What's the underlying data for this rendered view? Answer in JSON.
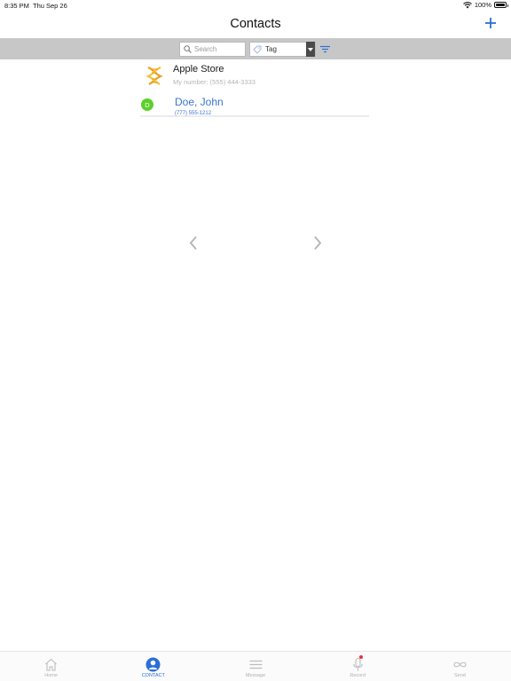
{
  "status_bar": {
    "time": "8:35 PM",
    "date": "Thu Sep 26",
    "battery": "100%"
  },
  "nav": {
    "title": "Contacts",
    "add_icon": "plus-icon"
  },
  "toolbar": {
    "search_placeholder": "Search",
    "tag_label": "Tag",
    "filter_icon": "filter-icon"
  },
  "contacts": [
    {
      "name": "Apple Store",
      "subtitle": "My number: (555) 444-3333",
      "avatar": "dna-icon"
    },
    {
      "name": "Doe, John",
      "subtitle": "(777) 555-1212",
      "avatar_letter": "D",
      "avatar_color": "#5bcf2a"
    }
  ],
  "colors": {
    "accent": "#2b6fd6",
    "toolbar_bg": "#c7c7c7",
    "contact_blue": "#3b74d1",
    "record_dot": "#e8313c"
  },
  "tabs": [
    {
      "label": "Home",
      "icon": "home-icon",
      "active": false
    },
    {
      "label": "CONTACT",
      "icon": "person-icon",
      "active": true
    },
    {
      "label": "Message",
      "icon": "menu-icon",
      "active": false
    },
    {
      "label": "Record",
      "icon": "microphone-icon",
      "active": false
    },
    {
      "label": "Send",
      "icon": "infinity-icon",
      "active": false
    }
  ]
}
